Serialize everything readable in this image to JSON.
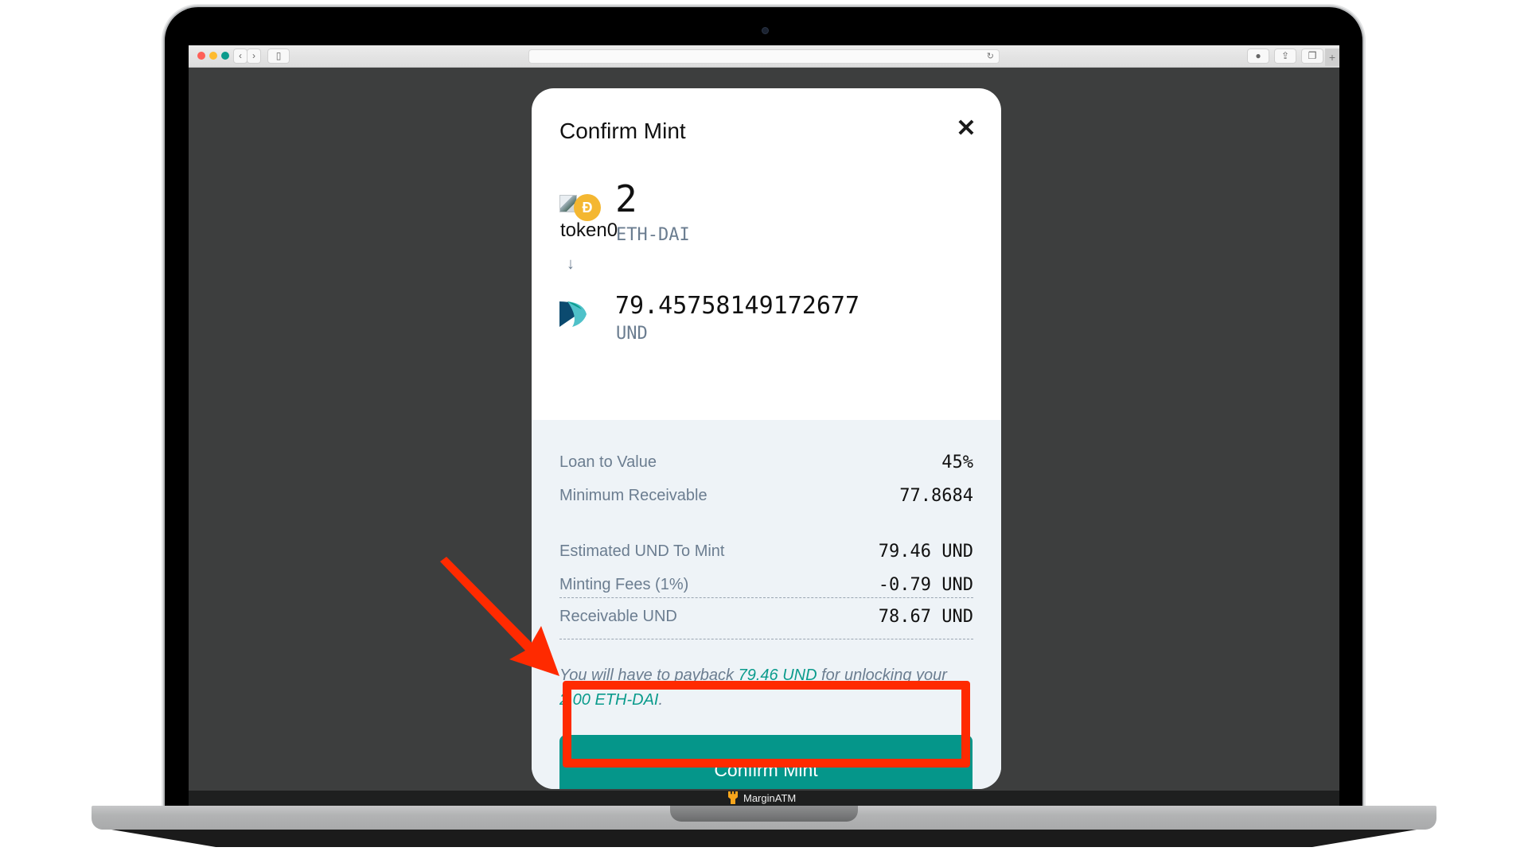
{
  "browser": {
    "reload_icon": "↻",
    "back_icon": "‹",
    "forward_icon": "›",
    "sidebar_icon": "▯",
    "download_icon": "●",
    "share_icon": "⇪",
    "tabs_icon": "❐",
    "new_tab_icon": "+"
  },
  "modal": {
    "title": "Confirm Mint",
    "close_icon": "✕",
    "from": {
      "image_alt": "token0",
      "coin_glyph": "Ð",
      "amount": "2",
      "symbol": "ETH-DAI"
    },
    "arrow_icon": "↓",
    "to": {
      "amount": "79.45758149172677",
      "symbol": "UND"
    },
    "details": [
      {
        "label": "Loan to Value",
        "value": "45%"
      },
      {
        "label": "Minimum Receivable",
        "value": "77.8684"
      },
      {
        "label": "Estimated UND To Mint",
        "value": "79.46 UND"
      },
      {
        "label": "Minting Fees (1%)",
        "value": "-0.79 UND"
      },
      {
        "label": "Receivable UND",
        "value": "78.67 UND"
      }
    ],
    "notice": {
      "part1": "You will have to payback ",
      "highlight1": "79.46 UND",
      "part2": " for unlocking your ",
      "highlight2": "2.00 ETH-DAI",
      "part3": "."
    },
    "confirm_label": "Confirm Mint"
  },
  "dock": {
    "app_name": "MarginATM"
  },
  "colors": {
    "accent": "#05968a",
    "annotation": "#ff2a00",
    "muted_text": "#6b7d90",
    "details_bg": "#eef3f7"
  }
}
